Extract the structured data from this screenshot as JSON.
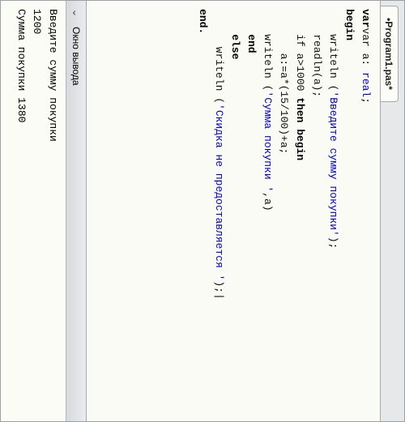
{
  "tab": {
    "title": "•Program1.pas*"
  },
  "code": {
    "line1_pre": "var a: ",
    "line1_type": "real",
    "line1_post": ";",
    "line2": "begin",
    "line3_pre": "    writeln (",
    "line3_str": "'Введите сумму покупки'",
    "line3_post": ");",
    "line4": "    readln(a);",
    "line5_pre": "    if a>1000 ",
    "line5_kw": "then begin",
    "line6": "       a:=a*(15/100)+a;",
    "line7_pre": "    writeln (",
    "line7_str": "'Сумма покупки '",
    "line7_post": ",a)",
    "line8": "    end",
    "line9": "    else",
    "line10_pre": "      writeln (",
    "line10_str": "'Скидка не предоставляется '",
    "line10_post": ");",
    "line11": "end."
  },
  "output": {
    "title": "Окно вывода",
    "line1": "Введите сумму покупки",
    "line2": "1200",
    "line3": "Сумма покупки 1380"
  }
}
